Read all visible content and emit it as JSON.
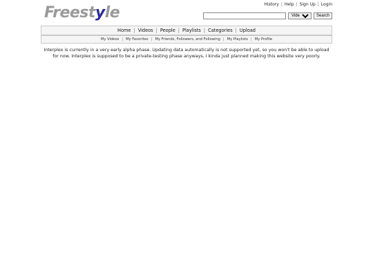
{
  "logo": {
    "text_pre": "Freest",
    "text_mid": "y",
    "text_post": "le"
  },
  "toplinks": [
    "History",
    "Help",
    "Sign Up",
    "Login"
  ],
  "search": {
    "value": "",
    "placeholder": "",
    "scope": "Videos",
    "button": "Search"
  },
  "nav": [
    "Home",
    "Videos",
    "People",
    "Playlists",
    "Categories",
    "Upload"
  ],
  "subnav": [
    "My Videos",
    "My Favorites",
    "My Friends, Followers, and Following",
    "My Playlists",
    "My Profile"
  ],
  "notice": "Interplex is currently in a very early alpha phase. Updating data automatically is not supported yet, so you won't be able to upload for now. Interplex is supposed to be a private-testing phase anyways, I kinda just planned making this website very poorly."
}
